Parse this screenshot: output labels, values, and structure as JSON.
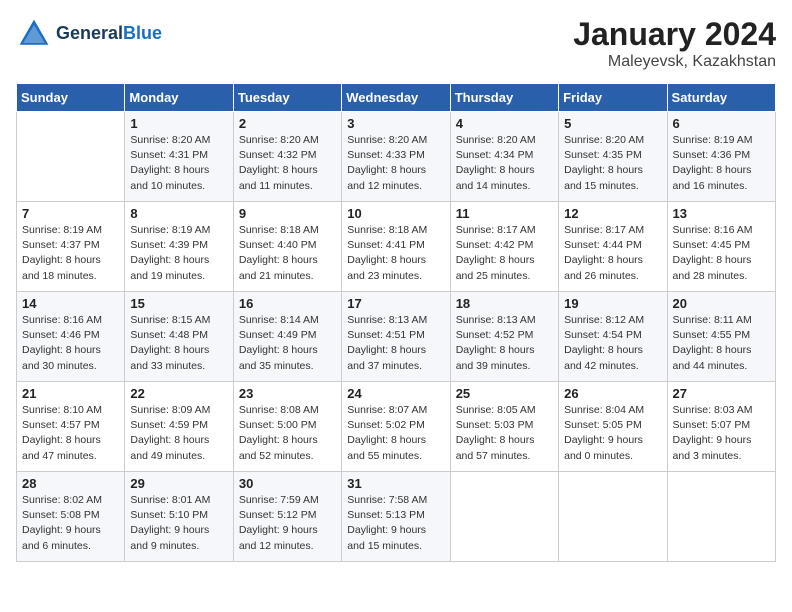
{
  "header": {
    "logo_line1": "General",
    "logo_line2": "Blue",
    "month": "January 2024",
    "location": "Maleyevsk, Kazakhstan"
  },
  "weekdays": [
    "Sunday",
    "Monday",
    "Tuesday",
    "Wednesday",
    "Thursday",
    "Friday",
    "Saturday"
  ],
  "weeks": [
    [
      {
        "num": "",
        "info": ""
      },
      {
        "num": "1",
        "info": "Sunrise: 8:20 AM\nSunset: 4:31 PM\nDaylight: 8 hours\nand 10 minutes."
      },
      {
        "num": "2",
        "info": "Sunrise: 8:20 AM\nSunset: 4:32 PM\nDaylight: 8 hours\nand 11 minutes."
      },
      {
        "num": "3",
        "info": "Sunrise: 8:20 AM\nSunset: 4:33 PM\nDaylight: 8 hours\nand 12 minutes."
      },
      {
        "num": "4",
        "info": "Sunrise: 8:20 AM\nSunset: 4:34 PM\nDaylight: 8 hours\nand 14 minutes."
      },
      {
        "num": "5",
        "info": "Sunrise: 8:20 AM\nSunset: 4:35 PM\nDaylight: 8 hours\nand 15 minutes."
      },
      {
        "num": "6",
        "info": "Sunrise: 8:19 AM\nSunset: 4:36 PM\nDaylight: 8 hours\nand 16 minutes."
      }
    ],
    [
      {
        "num": "7",
        "info": "Sunrise: 8:19 AM\nSunset: 4:37 PM\nDaylight: 8 hours\nand 18 minutes."
      },
      {
        "num": "8",
        "info": "Sunrise: 8:19 AM\nSunset: 4:39 PM\nDaylight: 8 hours\nand 19 minutes."
      },
      {
        "num": "9",
        "info": "Sunrise: 8:18 AM\nSunset: 4:40 PM\nDaylight: 8 hours\nand 21 minutes."
      },
      {
        "num": "10",
        "info": "Sunrise: 8:18 AM\nSunset: 4:41 PM\nDaylight: 8 hours\nand 23 minutes."
      },
      {
        "num": "11",
        "info": "Sunrise: 8:17 AM\nSunset: 4:42 PM\nDaylight: 8 hours\nand 25 minutes."
      },
      {
        "num": "12",
        "info": "Sunrise: 8:17 AM\nSunset: 4:44 PM\nDaylight: 8 hours\nand 26 minutes."
      },
      {
        "num": "13",
        "info": "Sunrise: 8:16 AM\nSunset: 4:45 PM\nDaylight: 8 hours\nand 28 minutes."
      }
    ],
    [
      {
        "num": "14",
        "info": "Sunrise: 8:16 AM\nSunset: 4:46 PM\nDaylight: 8 hours\nand 30 minutes."
      },
      {
        "num": "15",
        "info": "Sunrise: 8:15 AM\nSunset: 4:48 PM\nDaylight: 8 hours\nand 33 minutes."
      },
      {
        "num": "16",
        "info": "Sunrise: 8:14 AM\nSunset: 4:49 PM\nDaylight: 8 hours\nand 35 minutes."
      },
      {
        "num": "17",
        "info": "Sunrise: 8:13 AM\nSunset: 4:51 PM\nDaylight: 8 hours\nand 37 minutes."
      },
      {
        "num": "18",
        "info": "Sunrise: 8:13 AM\nSunset: 4:52 PM\nDaylight: 8 hours\nand 39 minutes."
      },
      {
        "num": "19",
        "info": "Sunrise: 8:12 AM\nSunset: 4:54 PM\nDaylight: 8 hours\nand 42 minutes."
      },
      {
        "num": "20",
        "info": "Sunrise: 8:11 AM\nSunset: 4:55 PM\nDaylight: 8 hours\nand 44 minutes."
      }
    ],
    [
      {
        "num": "21",
        "info": "Sunrise: 8:10 AM\nSunset: 4:57 PM\nDaylight: 8 hours\nand 47 minutes."
      },
      {
        "num": "22",
        "info": "Sunrise: 8:09 AM\nSunset: 4:59 PM\nDaylight: 8 hours\nand 49 minutes."
      },
      {
        "num": "23",
        "info": "Sunrise: 8:08 AM\nSunset: 5:00 PM\nDaylight: 8 hours\nand 52 minutes."
      },
      {
        "num": "24",
        "info": "Sunrise: 8:07 AM\nSunset: 5:02 PM\nDaylight: 8 hours\nand 55 minutes."
      },
      {
        "num": "25",
        "info": "Sunrise: 8:05 AM\nSunset: 5:03 PM\nDaylight: 8 hours\nand 57 minutes."
      },
      {
        "num": "26",
        "info": "Sunrise: 8:04 AM\nSunset: 5:05 PM\nDaylight: 9 hours\nand 0 minutes."
      },
      {
        "num": "27",
        "info": "Sunrise: 8:03 AM\nSunset: 5:07 PM\nDaylight: 9 hours\nand 3 minutes."
      }
    ],
    [
      {
        "num": "28",
        "info": "Sunrise: 8:02 AM\nSunset: 5:08 PM\nDaylight: 9 hours\nand 6 minutes."
      },
      {
        "num": "29",
        "info": "Sunrise: 8:01 AM\nSunset: 5:10 PM\nDaylight: 9 hours\nand 9 minutes."
      },
      {
        "num": "30",
        "info": "Sunrise: 7:59 AM\nSunset: 5:12 PM\nDaylight: 9 hours\nand 12 minutes."
      },
      {
        "num": "31",
        "info": "Sunrise: 7:58 AM\nSunset: 5:13 PM\nDaylight: 9 hours\nand 15 minutes."
      },
      {
        "num": "",
        "info": ""
      },
      {
        "num": "",
        "info": ""
      },
      {
        "num": "",
        "info": ""
      }
    ]
  ]
}
